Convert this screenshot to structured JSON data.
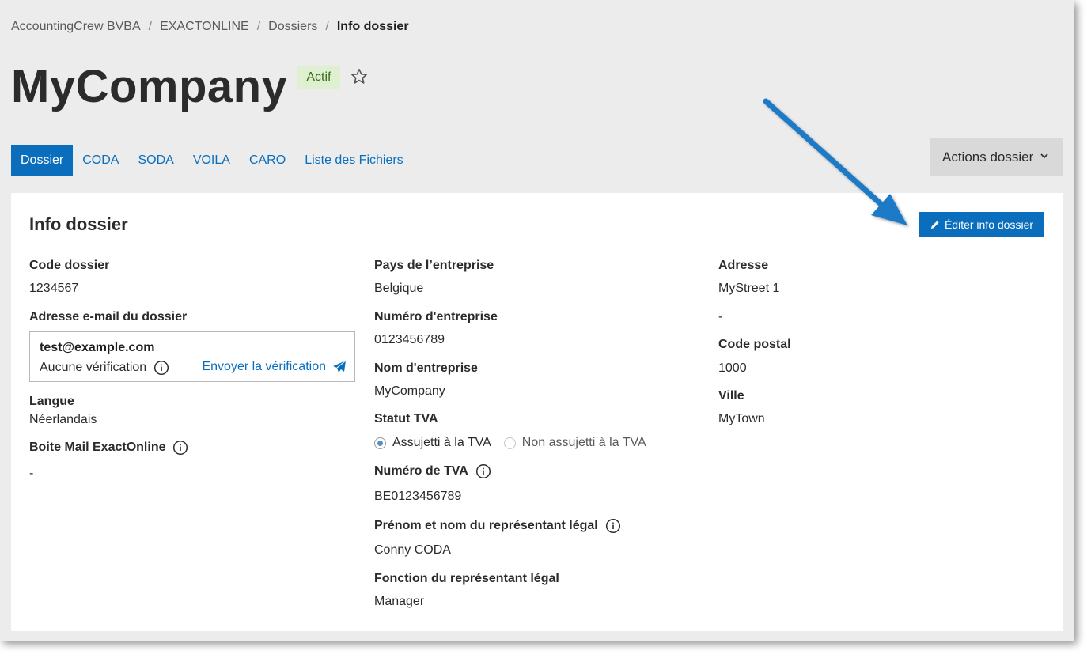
{
  "breadcrumb": [
    "AccountingCrew BVBA",
    "EXACTONLINE",
    "Dossiers",
    "Info dossier"
  ],
  "header": {
    "title": "MyCompany",
    "status": "Actif"
  },
  "tabs": [
    "Dossier",
    "CODA",
    "SODA",
    "VOILA",
    "CARO",
    "Liste des Fichiers"
  ],
  "actions_label": "Actions dossier",
  "card": {
    "title": "Info dossier",
    "edit_label": "Éditer info dossier"
  },
  "col1": {
    "code_label": "Code dossier",
    "code_value": "1234567",
    "email_label": "Adresse e-mail du dossier",
    "email_value": "test@example.com",
    "verification_status": "Aucune vérification",
    "send_verification": "Envoyer la vérification",
    "lang_label": "Langue",
    "lang_value": "Néerlandais",
    "mailbox_label": "Boite Mail ExactOnline",
    "mailbox_value": "-"
  },
  "col2": {
    "country_label": "Pays de l’entreprise",
    "country_value": "Belgique",
    "number_label": "Numéro d'entreprise",
    "number_value": "0123456789",
    "name_label": "Nom d'entreprise",
    "name_value": "MyCompany",
    "vat_status_label": "Statut TVA",
    "vat_option_1": "Assujetti à la TVA",
    "vat_option_2": "Non assujetti à la TVA",
    "vat_number_label": "Numéro de TVA",
    "vat_number_value": "BE0123456789",
    "rep_name_label": "Prénom et nom du représentant légal",
    "rep_name_value": "Conny CODA",
    "rep_function_label": "Fonction du représentant légal",
    "rep_function_value": "Manager"
  },
  "col3": {
    "address_label": "Adresse",
    "address_line1": "MyStreet 1",
    "address_line2": "-",
    "postal_label": "Code postal",
    "postal_value": "1000",
    "city_label": "Ville",
    "city_value": "MyTown"
  },
  "colors": {
    "accent": "#0a6ebd",
    "badge_bg": "#dff0d0",
    "arrow": "#1f7ac6"
  }
}
